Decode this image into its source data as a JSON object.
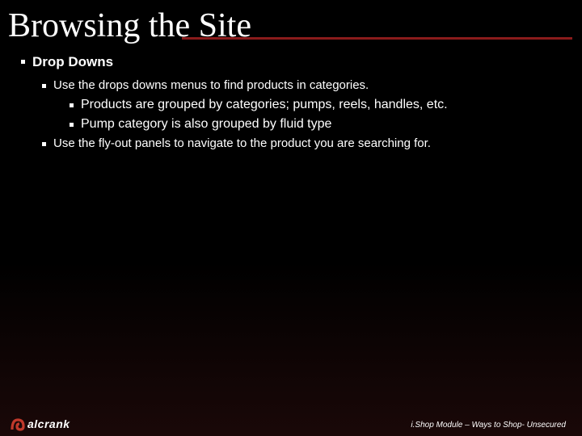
{
  "title": "Browsing the Site",
  "bullets": {
    "heading": "Drop Downs",
    "sub1": "Use the drops downs menus to find products in categories.",
    "sub1a": "Products are grouped by categories; pumps, reels, handles, etc.",
    "sub1b": "Pump category is also grouped by fluid type",
    "sub2": "Use the fly-out panels to navigate to the product you are searching for."
  },
  "logo_text": "alcrank",
  "footer": "i.Shop Module – Ways to Shop- Unsecured"
}
